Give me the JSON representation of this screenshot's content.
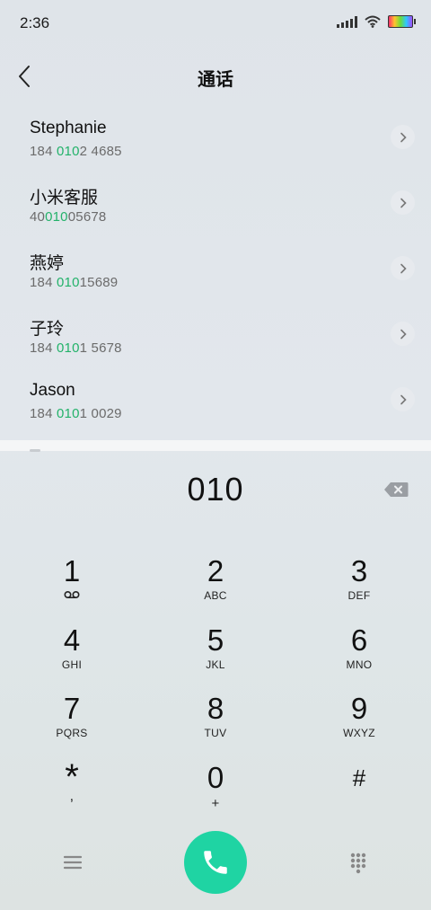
{
  "status": {
    "time": "2:36"
  },
  "header": {
    "title": "通话"
  },
  "results": [
    {
      "name": "Stephanie",
      "number_pre": "184 ",
      "number_match": "010",
      "number_post": "2 4685"
    },
    {
      "name": "小米客服",
      "number_pre": "40",
      "number_match": "010",
      "number_post": "05678"
    },
    {
      "name": "燕婷",
      "number_pre": "184 ",
      "number_match": "010",
      "number_post": "15689"
    },
    {
      "name": "子玲",
      "number_pre": "184 ",
      "number_match": "010",
      "number_post": "1 5678"
    },
    {
      "name": "Jason",
      "number_pre": "184 ",
      "number_match": "010",
      "number_post": "1 0029"
    }
  ],
  "dialer": {
    "entered": "010",
    "keys": [
      {
        "digit": "1",
        "sub": ""
      },
      {
        "digit": "2",
        "sub": "ABC"
      },
      {
        "digit": "3",
        "sub": "DEF"
      },
      {
        "digit": "4",
        "sub": "GHI"
      },
      {
        "digit": "5",
        "sub": "JKL"
      },
      {
        "digit": "6",
        "sub": "MNO"
      },
      {
        "digit": "7",
        "sub": "PQRS"
      },
      {
        "digit": "8",
        "sub": "TUV"
      },
      {
        "digit": "9",
        "sub": "WXYZ"
      },
      {
        "digit": "*",
        "sub": ","
      },
      {
        "digit": "0",
        "sub": "+"
      },
      {
        "digit": "#",
        "sub": ""
      }
    ]
  },
  "colors": {
    "match_highlight": "#23b26a",
    "call_button": "#1fd4a3"
  },
  "icons": {
    "back": "chevron-left-icon",
    "detail": "chevron-right-icon",
    "backspace": "backspace-icon",
    "voicemail": "voicemail-icon",
    "menu": "menu-icon",
    "call": "phone-icon",
    "keypad": "dialpad-icon"
  }
}
